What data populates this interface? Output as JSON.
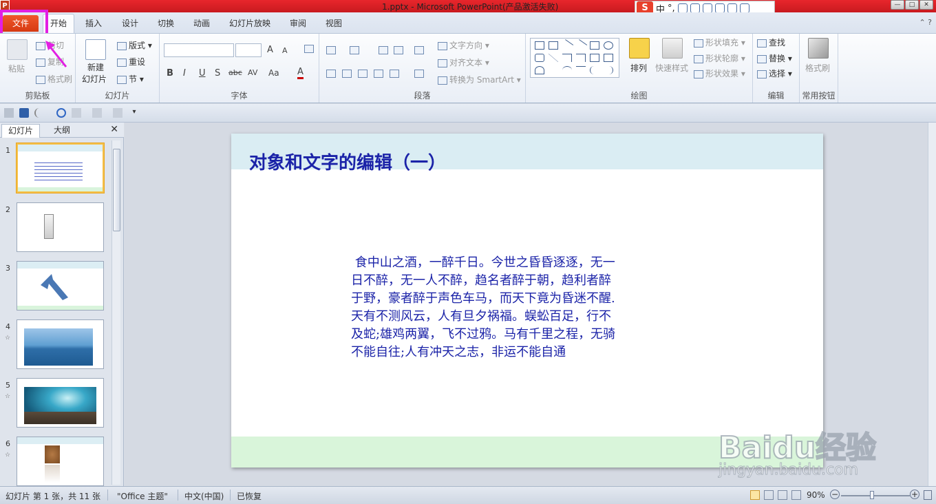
{
  "window": {
    "title": "1.pptx - Microsoft PowerPoint(产品激活失败)",
    "app_icon": "P"
  },
  "ime": {
    "logo": "S",
    "lang": "中",
    "punct": "°,"
  },
  "tabs": [
    {
      "label": "文件"
    },
    {
      "label": "开始"
    },
    {
      "label": "插入"
    },
    {
      "label": "设计"
    },
    {
      "label": "切换"
    },
    {
      "label": "动画"
    },
    {
      "label": "幻灯片放映"
    },
    {
      "label": "审阅"
    },
    {
      "label": "视图"
    }
  ],
  "ribbon": {
    "clipboard": {
      "label": "剪贴板",
      "paste": "粘贴",
      "cut": "剪切",
      "copy": "复制",
      "format_painter": "格式刷"
    },
    "slides": {
      "label": "幻灯片",
      "new_slide_1": "新建",
      "new_slide_2": "幻灯片",
      "layout": "版式",
      "reset": "重设",
      "section": "节"
    },
    "font": {
      "label": "字体",
      "bold": "B",
      "italic": "I",
      "underline": "U",
      "shadow": "S",
      "strike": "abc",
      "spacing": "AV",
      "case": "Aa",
      "color": "A",
      "grow": "A",
      "shrink": "A"
    },
    "paragraph": {
      "label": "段落",
      "text_direction": "文字方向",
      "align_text": "对齐文本",
      "smartart": "转换为 SmartArt"
    },
    "drawing": {
      "label": "绘图",
      "arrange": "排列",
      "quick_styles": "快速样式",
      "shape_fill": "形状填充",
      "shape_outline": "形状轮廓",
      "shape_effects": "形状效果"
    },
    "editing": {
      "label": "编辑",
      "find": "查找",
      "replace": "替换",
      "select": "选择"
    },
    "common": {
      "label": "常用按钮",
      "format_painter": "格式刷"
    }
  },
  "left_pane": {
    "tab_slides": "幻灯片",
    "tab_outline": "大纲",
    "close": "✕",
    "thumbnails": [
      {
        "num": "1",
        "star": ""
      },
      {
        "num": "2",
        "star": ""
      },
      {
        "num": "3",
        "star": ""
      },
      {
        "num": "4",
        "star": "☆"
      },
      {
        "num": "5",
        "star": "☆"
      },
      {
        "num": "6",
        "star": "☆"
      }
    ]
  },
  "slide": {
    "title": "对象和文字的编辑（一）",
    "body_lines": [
      " 食中山之酒，一醉千日。今世之昏昏逐逐，无一",
      "日不醉，无一人不醉，趋名者醉于朝，趋利者醉",
      "于野，豪者醉于声色车马，而天下竟为昏迷不醒.",
      "天有不测风云，人有旦夕祸福。蜈蚣百足，行不",
      "及蛇;雄鸡两翼，飞不过鸦。马有千里之程，无骑",
      "不能自往;人有冲天之志，非运不能自通"
    ]
  },
  "statusbar": {
    "slide_info": "幻灯片 第 1 张，共 11 张",
    "theme": "\"Office 主题\"",
    "language": "中文(中国)",
    "recovery": "已恢复",
    "zoom": "90%"
  },
  "watermark": {
    "brand": "Baidu经验",
    "url": "jingyan.baidu.com"
  },
  "colors": {
    "title_bar": "#d42025",
    "file_tab": "#e2481c",
    "highlight": "#e21fe3",
    "slide_text": "#1b23a8"
  }
}
